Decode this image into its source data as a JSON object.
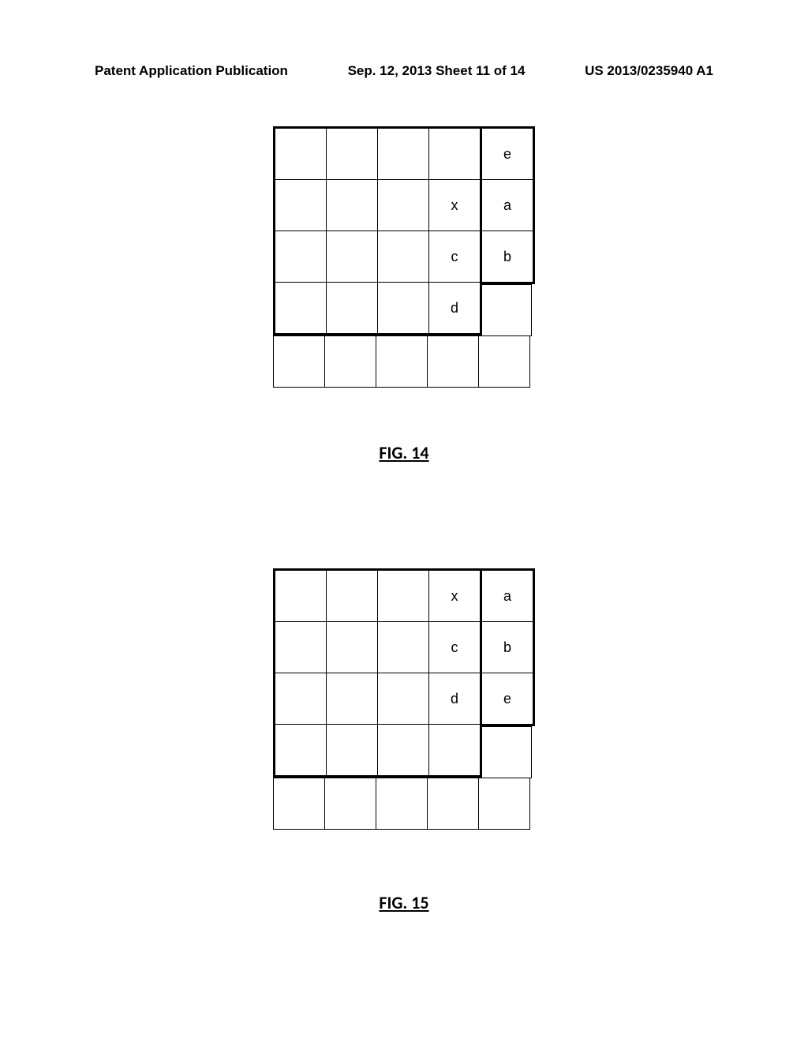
{
  "header": {
    "left": "Patent Application Publication",
    "center": "Sep. 12, 2013  Sheet 11 of 14",
    "right": "US 2013/0235940 A1"
  },
  "figure14": {
    "label": "FIG. 14",
    "leftGrid": {
      "rows": 4,
      "cols": 4,
      "cells": [
        [
          "",
          "",
          "",
          ""
        ],
        [
          "",
          "",
          "",
          "x"
        ],
        [
          "",
          "",
          "",
          "c"
        ],
        [
          "",
          "",
          "",
          "d"
        ]
      ]
    },
    "rightGrid": {
      "rows": 3,
      "cols": 1,
      "cells": [
        [
          "e"
        ],
        [
          "a"
        ],
        [
          "b"
        ]
      ]
    },
    "bottomRow": {
      "cols": 5,
      "cells": [
        "",
        "",
        "",
        "",
        ""
      ]
    }
  },
  "figure15": {
    "label": "FIG. 15",
    "leftGrid": {
      "rows": 4,
      "cols": 4,
      "cells": [
        [
          "",
          "",
          "",
          "x"
        ],
        [
          "",
          "",
          "",
          "c"
        ],
        [
          "",
          "",
          "",
          "d"
        ],
        [
          "",
          "",
          "",
          ""
        ]
      ]
    },
    "rightGrid": {
      "rows": 3,
      "cols": 1,
      "cells": [
        [
          "a"
        ],
        [
          "b"
        ],
        [
          "e"
        ]
      ]
    },
    "bottomRow": {
      "cols": 5,
      "cells": [
        "",
        "",
        "",
        "",
        ""
      ]
    }
  }
}
